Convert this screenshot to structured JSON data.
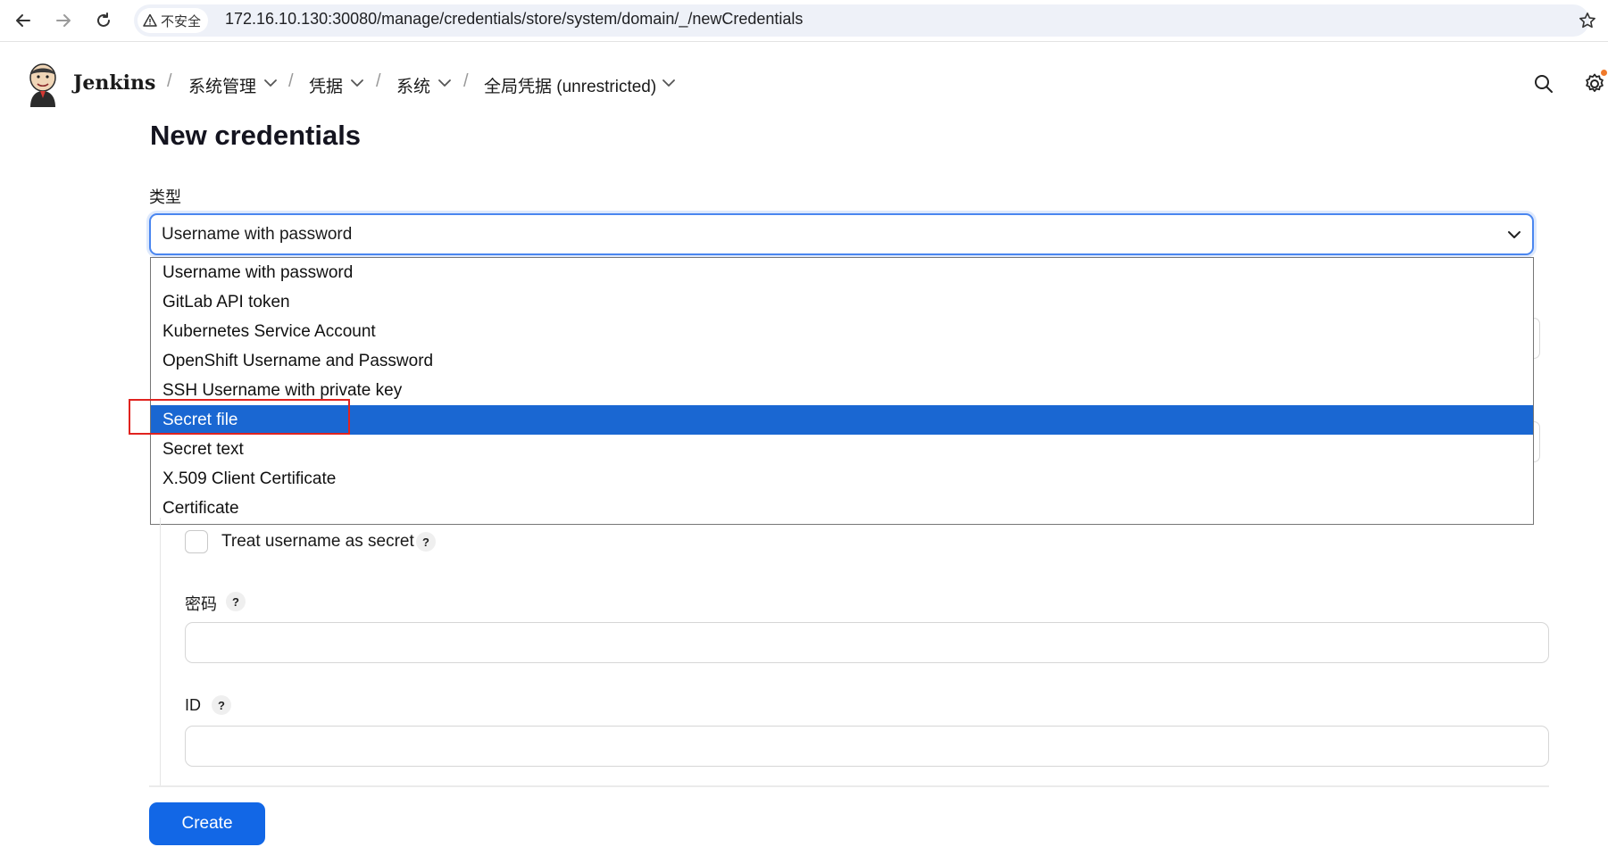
{
  "browser": {
    "security_label": "不安全",
    "url": "172.16.10.130:30080/manage/credentials/store/system/domain/_/newCredentials"
  },
  "header": {
    "brand": "Jenkins",
    "breadcrumbs": [
      {
        "label": "系统管理"
      },
      {
        "label": "凭据"
      },
      {
        "label": "系统"
      },
      {
        "label": "全局凭据 (unrestricted)"
      }
    ]
  },
  "page": {
    "title": "New credentials",
    "type_label": "类型",
    "type_selected": "Username with password"
  },
  "dropdown": {
    "options": [
      "Username with password",
      "GitLab API token",
      "Kubernetes Service Account",
      "OpenShift Username and Password",
      "SSH Username with private key",
      "Secret file",
      "Secret text",
      "X.509 Client Certificate",
      "Certificate"
    ],
    "highlighted": "Secret file"
  },
  "form": {
    "treat_username_label": "Treat username as secret",
    "password_label": "密码",
    "id_label": "ID",
    "help_glyph": "?",
    "create_label": "Create"
  },
  "colors": {
    "accent": "#1267e6",
    "highlight": "#1a67d2",
    "annotation": "#e0231f"
  }
}
